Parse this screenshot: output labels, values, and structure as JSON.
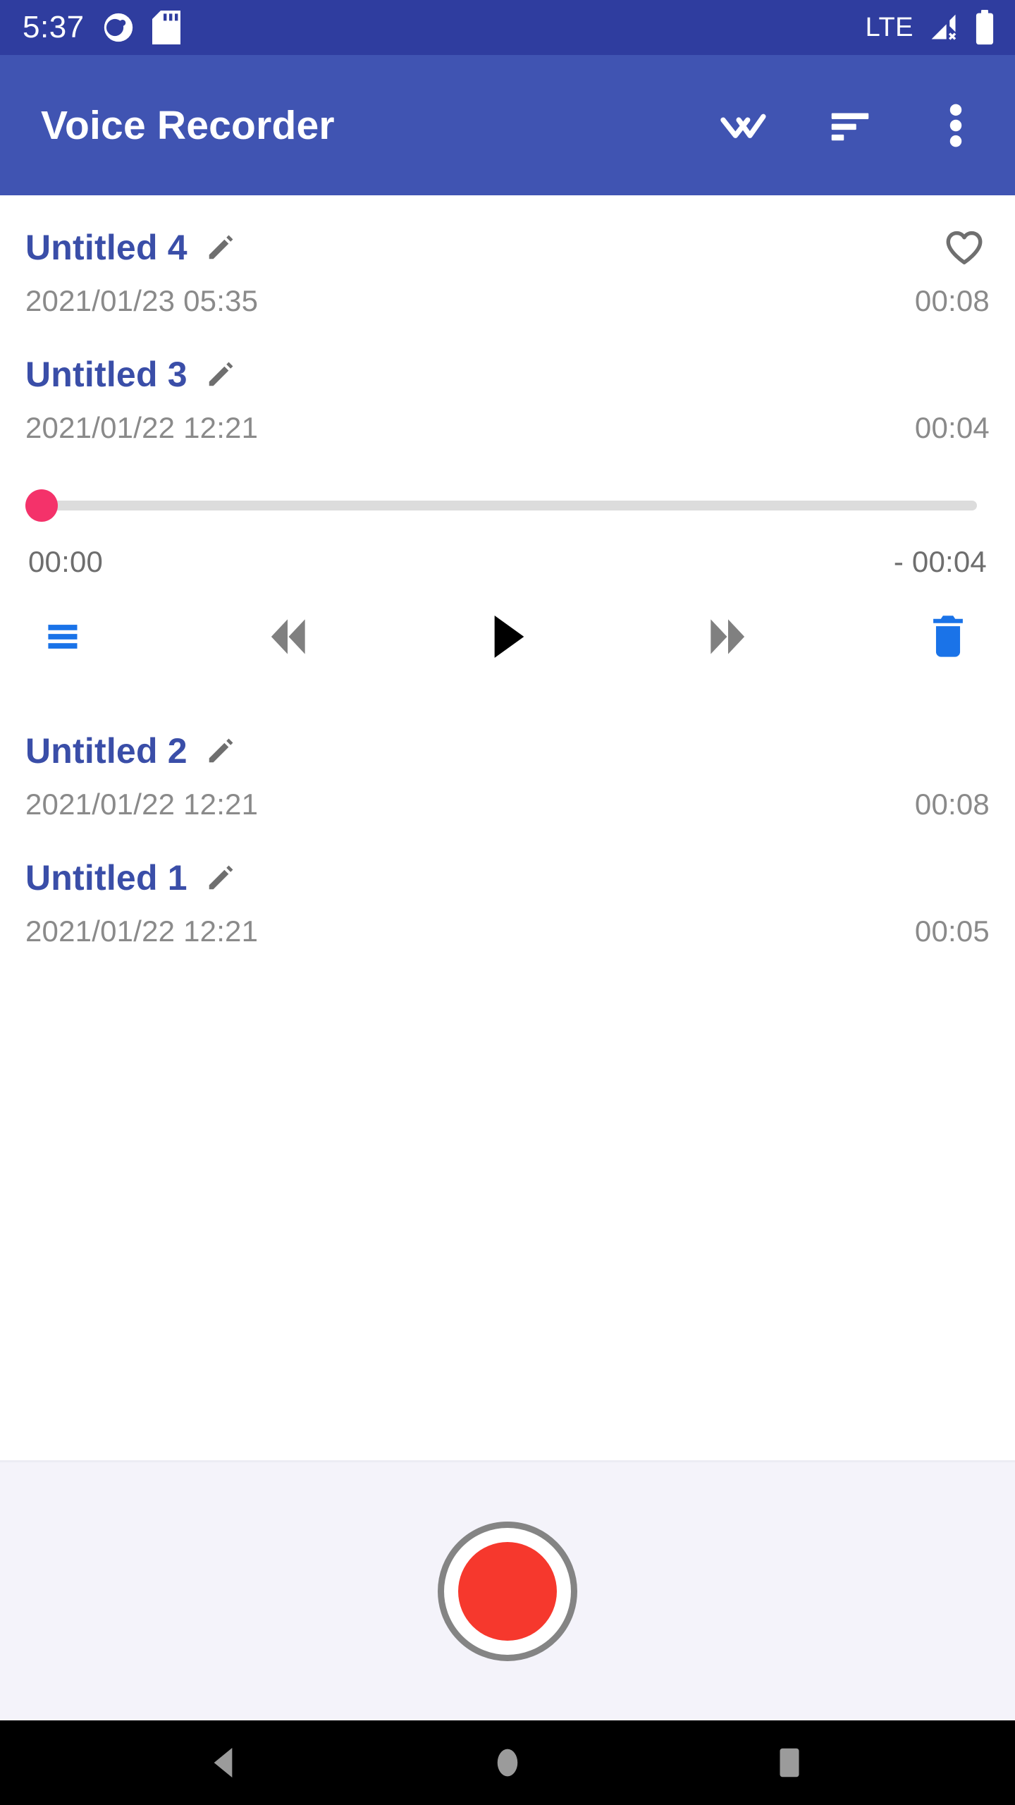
{
  "status_bar": {
    "time": "5:37",
    "network_label": "LTE",
    "icons": [
      "notification-circle-icon",
      "sd-card-icon",
      "signal-off-icon",
      "battery-full-icon"
    ],
    "background_color": "#2f3d9f"
  },
  "app_bar": {
    "title": "Voice Recorder",
    "background_color": "#4054b2",
    "actions": [
      {
        "name": "select-all-icon",
        "label": "Select all"
      },
      {
        "name": "sort-icon",
        "label": "Sort"
      },
      {
        "name": "overflow-menu-icon",
        "label": "More options"
      }
    ]
  },
  "recordings": [
    {
      "title": "Untitled 4",
      "date": "2021/01/23 05:35",
      "duration": "00:08",
      "favorite": false,
      "expanded": false
    },
    {
      "title": "Untitled 3",
      "date": "2021/01/22 12:21",
      "duration": "00:04",
      "favorite": false,
      "expanded": true
    },
    {
      "title": "Untitled 2",
      "date": "2021/01/22 12:21",
      "duration": "00:08",
      "favorite": false,
      "expanded": false
    },
    {
      "title": "Untitled 1",
      "date": "2021/01/22 12:21",
      "duration": "00:05",
      "favorite": false,
      "expanded": false
    }
  ],
  "player": {
    "current_time": "00:00",
    "remaining_time": "- 00:04",
    "progress_percent": 0,
    "thumb_color": "#f4326a",
    "track_color": "#dcdcdc",
    "controls": [
      {
        "name": "playlist-icon",
        "label": "Playlist",
        "color": "#1a73e8"
      },
      {
        "name": "rewind-icon",
        "label": "Rewind",
        "color": "#808080"
      },
      {
        "name": "play-icon",
        "label": "Play",
        "color": "#000000"
      },
      {
        "name": "fast-forward-icon",
        "label": "Fast forward",
        "color": "#808080"
      },
      {
        "name": "delete-icon",
        "label": "Delete",
        "color": "#1a73e8"
      }
    ]
  },
  "record_panel": {
    "button_label": "Record",
    "background_color": "#f4f3fa",
    "inner_color": "#f6382d",
    "ring_color": "#848484"
  },
  "nav_bar": {
    "buttons": [
      {
        "name": "nav-back-icon",
        "label": "Back"
      },
      {
        "name": "nav-home-icon",
        "label": "Home"
      },
      {
        "name": "nav-recents-icon",
        "label": "Recents"
      }
    ]
  }
}
